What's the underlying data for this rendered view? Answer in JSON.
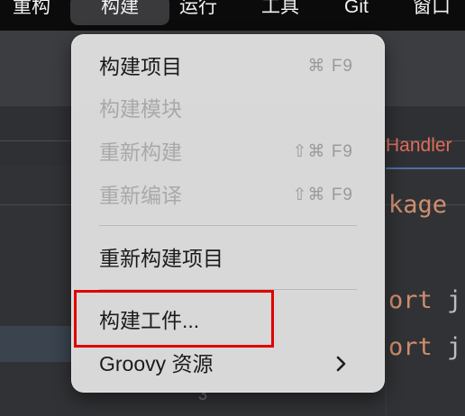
{
  "menubar": {
    "items": [
      "重构",
      "构建",
      "运行",
      "工具",
      "Git",
      "窗口"
    ],
    "active_index": 1
  },
  "background": {
    "tab_label": "Handler",
    "code_lines": [
      {
        "keyword": "kage",
        "rest": ""
      },
      {
        "keyword": "ort",
        "rest": " j"
      },
      {
        "keyword": "ort",
        "rest": " j"
      }
    ],
    "line_number": "3"
  },
  "menu": {
    "items": [
      {
        "label": "构建项目",
        "shortcut": "⌘ F9",
        "enabled": true
      },
      {
        "label": "构建模块",
        "shortcut": "",
        "enabled": false
      },
      {
        "label": "重新构建",
        "shortcut": "⇧⌘ F9",
        "enabled": false
      },
      {
        "label": "重新编译",
        "shortcut": "⇧⌘ F9",
        "enabled": false
      },
      {
        "label": "重新构建项目",
        "shortcut": "",
        "enabled": true
      },
      {
        "label": "构建工件...",
        "shortcut": "",
        "enabled": true
      },
      {
        "label": "Groovy 资源",
        "shortcut": "",
        "enabled": true,
        "submenu": true
      }
    ],
    "submenu_icon": "chevron-right-icon"
  },
  "colors": {
    "highlight_border": "#e00000",
    "menu_background": "#dedede",
    "menubar_background": "#0b0b0c"
  }
}
